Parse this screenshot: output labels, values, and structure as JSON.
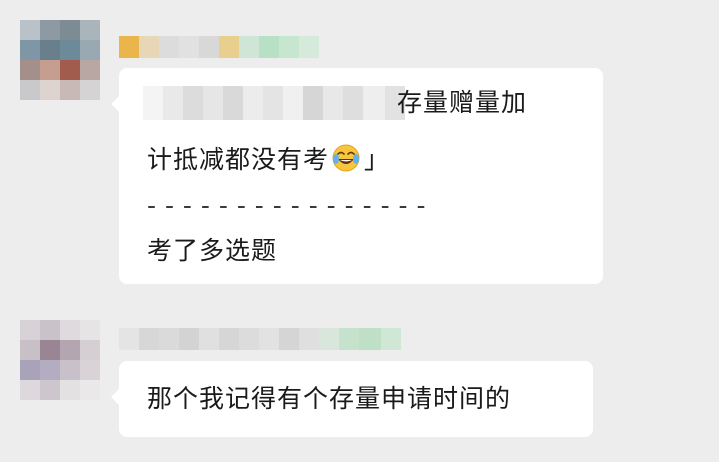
{
  "chat": {
    "messages": [
      {
        "quote_text": "存量赠量加",
        "quote_text_2": "计抵减都没有考",
        "quote_end": "」",
        "divider": "- - - - - - - - - - - - - - - -",
        "reply": "考了多选题",
        "emoji": "face-with-tears-of-joy-icon"
      },
      {
        "text": "那个我记得有个存量申请时间的"
      }
    ]
  },
  "colors": {
    "background": "#ededed",
    "bubble": "#ffffff",
    "text": "#1a1a1a"
  }
}
